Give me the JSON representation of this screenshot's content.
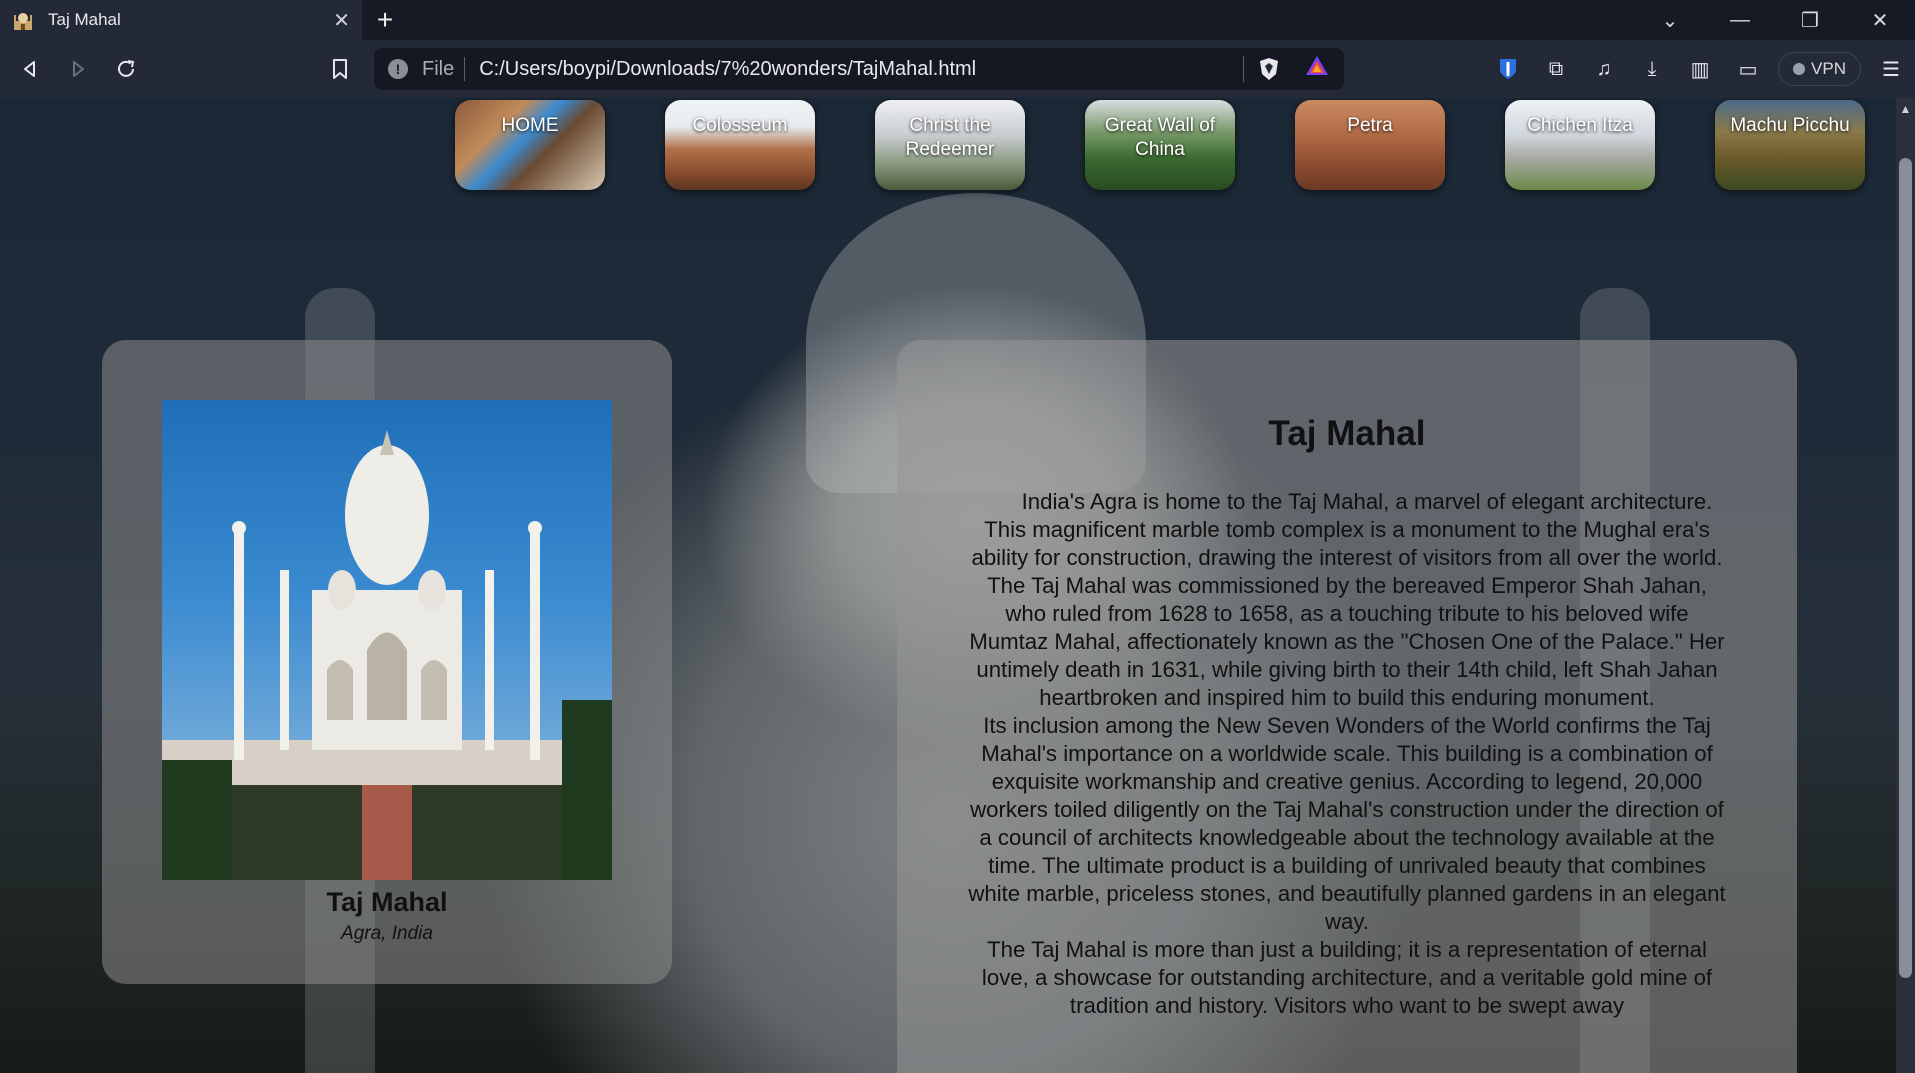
{
  "browser": {
    "tab_title": "Taj Mahal",
    "url_scheme": "File",
    "url": "C:/Users/boypi/Downloads/7%20wonders/TajMahal.html",
    "vpn_label": "VPN"
  },
  "nav": {
    "items": [
      {
        "label": "HOME"
      },
      {
        "label": "Colosseum"
      },
      {
        "label": "Christ the Redeemer"
      },
      {
        "label": "Great Wall of China"
      },
      {
        "label": "Petra"
      },
      {
        "label": "Chichen Itza"
      },
      {
        "label": "Machu Picchu"
      }
    ]
  },
  "card": {
    "name": "Taj Mahal",
    "location": "Agra, India"
  },
  "article": {
    "heading": "Taj Mahal",
    "p1": "India's Agra is home to the Taj Mahal, a marvel of elegant architecture. This magnificent marble tomb complex is a monument to the Mughal era's ability for construction, drawing the interest of visitors from all over the world. The Taj Mahal was commissioned by the bereaved Emperor Shah Jahan, who ruled from 1628 to 1658, as a touching tribute to his beloved wife Mumtaz Mahal, affectionately known as the \"Chosen One of the Palace.\" Her untimely death in 1631, while giving birth to their 14th child, left Shah Jahan heartbroken and inspired him to build this enduring monument.",
    "p2": "Its inclusion among the New Seven Wonders of the World confirms the Taj Mahal's importance on a worldwide scale. This building is a combination of exquisite workmanship and creative genius. According to legend, 20,000 workers toiled diligently on the Taj Mahal's construction under the direction of a council of architects knowledgeable about the technology available at the time. The ultimate product is a building of unrivaled beauty that combines white marble, priceless stones, and beautifully planned gardens in an elegant way.",
    "p3": "The Taj Mahal is more than just a building; it is a representation of eternal love, a showcase for outstanding architecture, and a veritable gold mine of tradition and history. Visitors who want to be swept away"
  }
}
